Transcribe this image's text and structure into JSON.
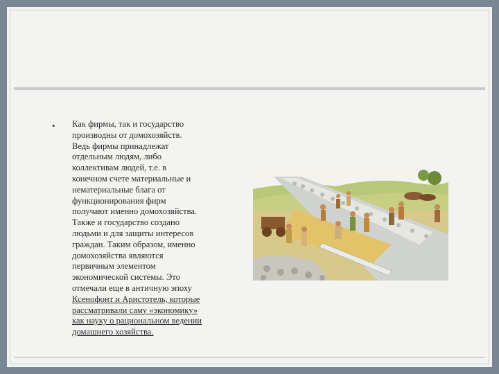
{
  "slide": {
    "bullet": "•",
    "paragraph_plain": "Как фирмы, так и государство\nпроизводны от домохозяйств.\nВедь фирмы принадлежат\nотдельным людям, либо\nколлективам людей, т.е. в\nконечном счете материальные и\nнематериальные блага от\nфункционирования фирм\nполучают именно домохозяйства.\nТакже и государство создано\nлюдьми и для защиты интересов\nграждан. Таким образом, именно\nдомохозяйства являются\nпервичным элементом\nэкономической системы. Это\nотмечали еще в античную эпоху\n",
    "paragraph_underlined": "Ксенофонт и Аристотель, которые\nрассматривали саму «экономику»\nкак науку о рациональном ведении\nдомашнего хозяйства.",
    "illustration": "roman-road-construction"
  },
  "colors": {
    "outer": "#7b8695",
    "slide": "#f3f3f1",
    "rule": "#c9c9c9"
  }
}
